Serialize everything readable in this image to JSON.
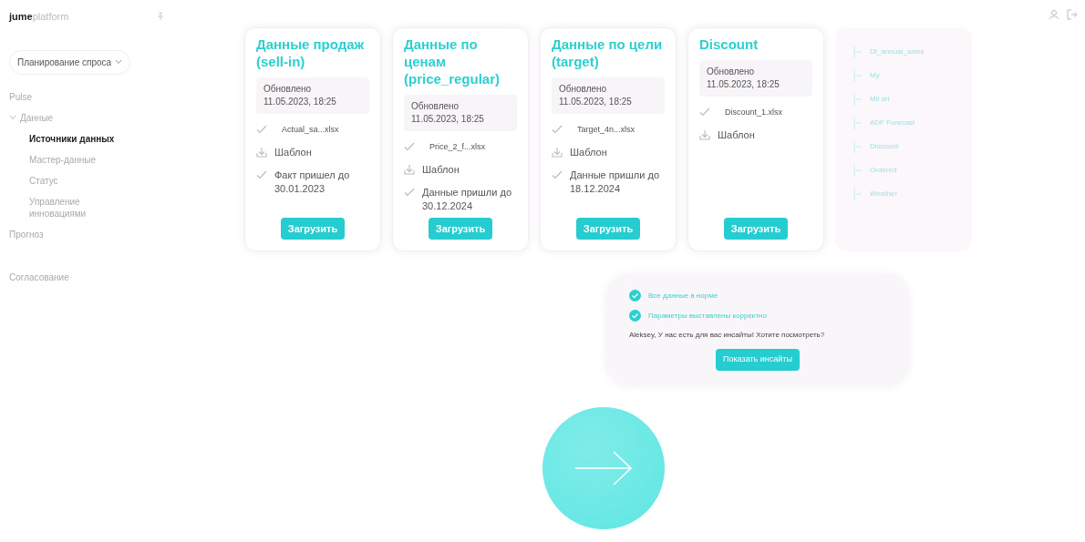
{
  "logo": {
    "brand": "jume",
    "product": "platform"
  },
  "sidebar": {
    "workspace": "Планирование спроса",
    "items": [
      {
        "label": "Pulse",
        "selected": false
      },
      {
        "label": "Данные",
        "selected": false,
        "expanded": true,
        "children": [
          {
            "label": "Источники данных",
            "selected": true
          },
          {
            "label": "Мастер-данные",
            "selected": false
          },
          {
            "label": "Статус",
            "selected": false
          },
          {
            "label": "Управление инновациями",
            "selected": false
          }
        ]
      },
      {
        "label": "Прогноз",
        "selected": false
      }
    ],
    "bottom_items": [
      {
        "label": "Согласование",
        "selected": false
      }
    ]
  },
  "cards": [
    {
      "title": "Данные продаж (sell-in)",
      "updated_label": "Обновлено",
      "updated": "11.05.2023, 18:25",
      "lines": [
        {
          "kind": "file",
          "text": "Actual_sa...xlsx"
        },
        {
          "kind": "template",
          "text": "Шаблон"
        },
        {
          "kind": "note",
          "text": "Факт пришел до 30.01.2023"
        }
      ],
      "button": "Загрузить"
    },
    {
      "title": "Данные по ценам (price_regular)",
      "updated_label": "Обновлено",
      "updated": "11.05.2023, 18:25",
      "lines": [
        {
          "kind": "file",
          "text": "Price_2_f...xlsx"
        },
        {
          "kind": "template",
          "text": "Шаблон"
        },
        {
          "kind": "note",
          "text": "Данные пришли до 30.12.2024"
        }
      ],
      "button": "Загрузить"
    },
    {
      "title": "Данные по цели (target)",
      "updated_label": "Обновлено",
      "updated": "11.05.2023, 18:25",
      "lines": [
        {
          "kind": "file",
          "text": "Target_4n...xlsx"
        },
        {
          "kind": "template",
          "text": "Шаблон"
        },
        {
          "kind": "note",
          "text": "Данные пришли до 18.12.2024"
        }
      ],
      "button": "Загрузить"
    },
    {
      "title": "Discount",
      "updated_label": "Обновлено",
      "updated": "11.05.2023, 18:25",
      "lines": [
        {
          "kind": "file",
          "text": "Discount_1.xlsx"
        },
        {
          "kind": "template",
          "text": "Шаблон"
        }
      ],
      "button": "Загрузить"
    }
  ],
  "sources": [
    "Dt_annual_sales",
    "My",
    "Mil art",
    "ADF Forecast",
    "Discount",
    "Ordered",
    "Weather"
  ],
  "insights": {
    "checks": [
      "Все данные в норме",
      "Параметры выставлены корректно"
    ],
    "message": "Aleksey, У нас есть для вас инсайты! Хотите посмотреть?",
    "button": "Показать инсайты"
  }
}
